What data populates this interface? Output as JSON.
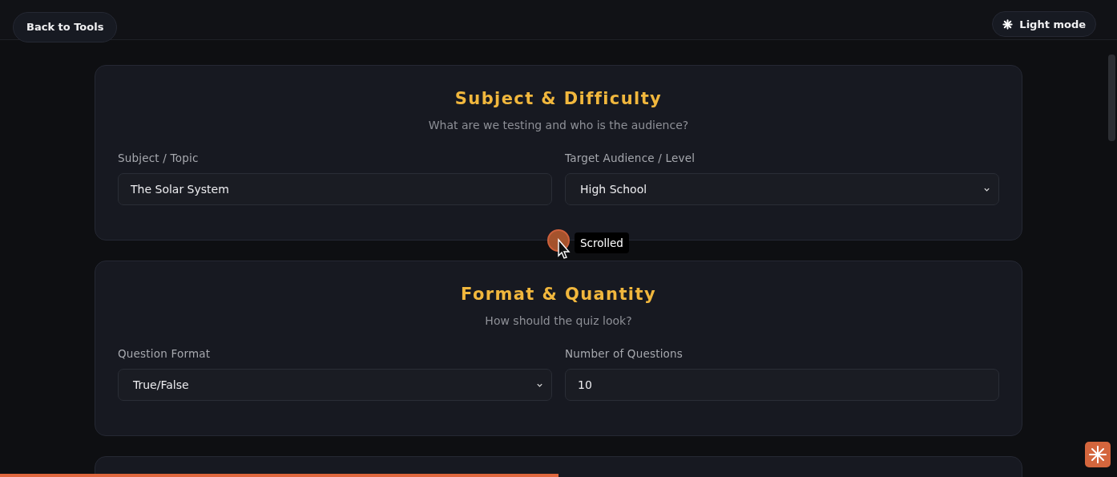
{
  "header": {
    "back_button": "Back to Tools",
    "theme_button": "Light mode"
  },
  "sections": [
    {
      "title": "Subject & Difficulty",
      "subtitle": "What are we testing and who is the audience?",
      "fields": [
        {
          "label": "Subject / Topic",
          "kind": "text",
          "value": "The Solar System"
        },
        {
          "label": "Target Audience / Level",
          "kind": "select",
          "value": "High School"
        }
      ]
    },
    {
      "title": "Format & Quantity",
      "subtitle": "How should the quiz look?",
      "fields": [
        {
          "label": "Question Format",
          "kind": "select",
          "value": "True/False"
        },
        {
          "label": "Number of Questions",
          "kind": "text",
          "value": "10"
        }
      ]
    }
  ],
  "cursor_tooltip": "Scrolled",
  "progress": {
    "level": 0.5
  }
}
